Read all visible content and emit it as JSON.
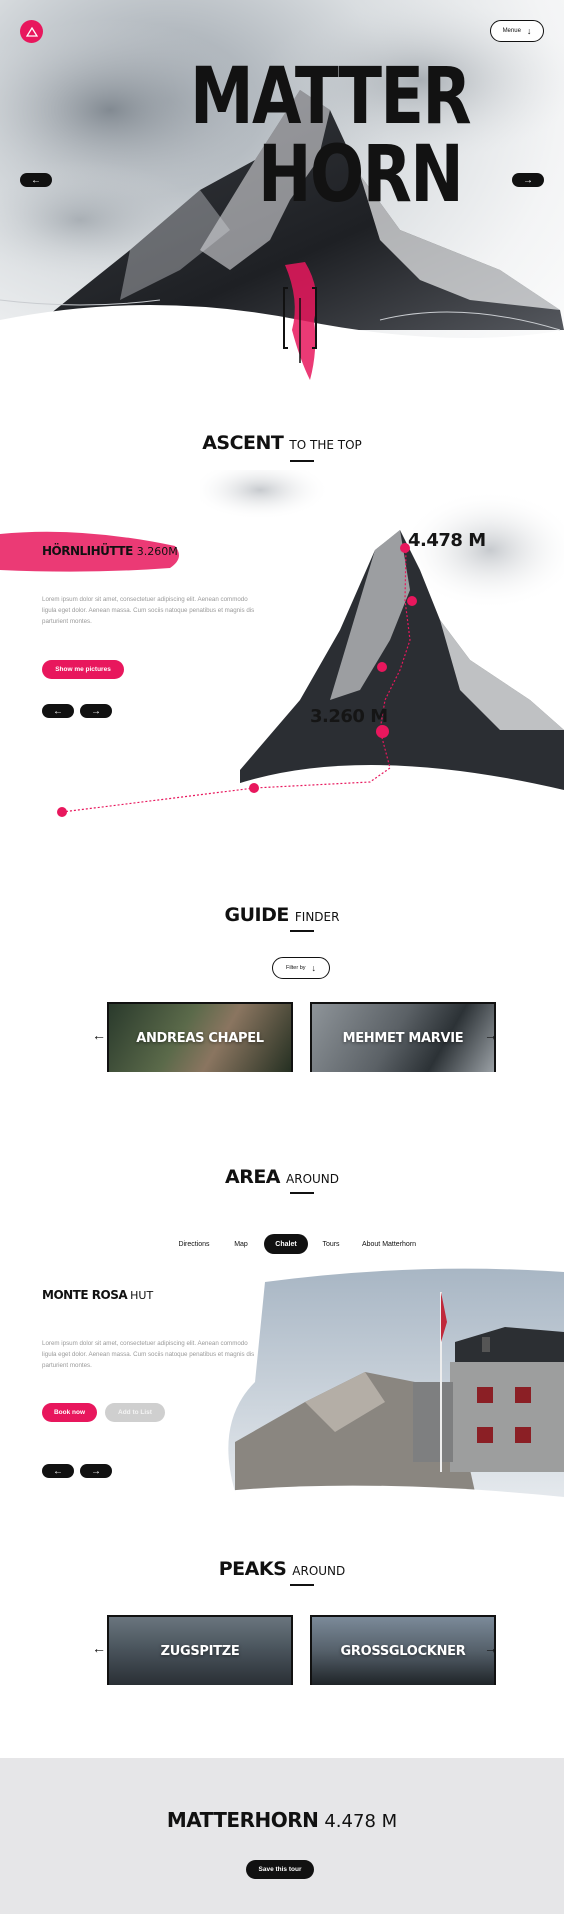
{
  "header": {
    "logo_icon": "mountain-icon",
    "menu_label": "Menue"
  },
  "hero": {
    "title_line1": "MATTER",
    "title_line2": "HORN"
  },
  "ascent": {
    "heading_bold": "ASCENT",
    "heading_light": "TO THE TOP",
    "stage_bold": "HÖRNLIHÜTTE",
    "stage_light": "3.260M",
    "description": "Lorem ipsum dolor sit amet, consectetuer adipiscing elit. Aenean commodo ligula eget dolor. Aenean massa. Cum sociis natoque penatibus et magnis dis parturient montes.",
    "button_label": "Show me pictures",
    "summit_label": "4.478 M",
    "hut_label": "3.260 M"
  },
  "guides": {
    "heading_bold": "GUIDE",
    "heading_light": "FINDER",
    "filter_label": "Filter by",
    "cards": [
      {
        "name": "ANDREAS CHAPEL"
      },
      {
        "name": "MEHMET MARVIE"
      }
    ]
  },
  "area": {
    "heading_bold": "AREA",
    "heading_light": "AROUND",
    "tabs": [
      {
        "label": "Directions"
      },
      {
        "label": "Map"
      },
      {
        "label": "Chalet"
      },
      {
        "label": "Tours"
      },
      {
        "label": "About Matterhorn"
      }
    ],
    "active_tab": "Chalet",
    "place_bold": "MONTE ROSA",
    "place_light": "HUT",
    "description": "Lorem ipsum dolor sit amet, consectetuer adipiscing elit. Aenean commodo ligula eget dolor. Aenean massa. Cum sociis natoque penatibus et magnis dis parturient montes.",
    "book_label": "Book now",
    "add_label": "Add to List"
  },
  "peaks": {
    "heading_bold": "PEAKS",
    "heading_light": "AROUND",
    "cards": [
      {
        "name": "ZUGSPITZE"
      },
      {
        "name": "GROSSGLOCKNER"
      }
    ]
  },
  "footer": {
    "title_bold": "MATTERHORN",
    "title_light": "4.478 M",
    "save_label": "Save this tour"
  },
  "colors": {
    "accent": "#e8175d",
    "dark": "#111111",
    "footer_bg": "#e6e6e8"
  }
}
